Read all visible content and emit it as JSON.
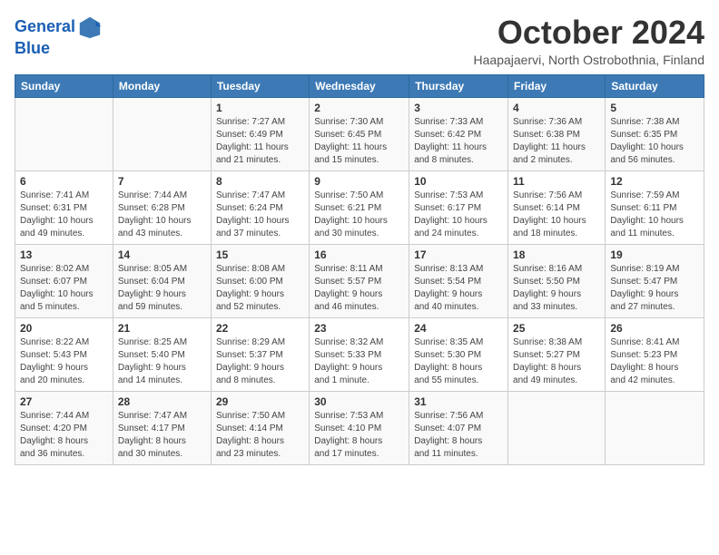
{
  "logo": {
    "line1": "General",
    "line2": "Blue"
  },
  "title": "October 2024",
  "subtitle": "Haapajaervi, North Ostrobothnia, Finland",
  "days_of_week": [
    "Sunday",
    "Monday",
    "Tuesday",
    "Wednesday",
    "Thursday",
    "Friday",
    "Saturday"
  ],
  "weeks": [
    [
      {
        "num": "",
        "info": ""
      },
      {
        "num": "",
        "info": ""
      },
      {
        "num": "1",
        "info": "Sunrise: 7:27 AM\nSunset: 6:49 PM\nDaylight: 11 hours\nand 21 minutes."
      },
      {
        "num": "2",
        "info": "Sunrise: 7:30 AM\nSunset: 6:45 PM\nDaylight: 11 hours\nand 15 minutes."
      },
      {
        "num": "3",
        "info": "Sunrise: 7:33 AM\nSunset: 6:42 PM\nDaylight: 11 hours\nand 8 minutes."
      },
      {
        "num": "4",
        "info": "Sunrise: 7:36 AM\nSunset: 6:38 PM\nDaylight: 11 hours\nand 2 minutes."
      },
      {
        "num": "5",
        "info": "Sunrise: 7:38 AM\nSunset: 6:35 PM\nDaylight: 10 hours\nand 56 minutes."
      }
    ],
    [
      {
        "num": "6",
        "info": "Sunrise: 7:41 AM\nSunset: 6:31 PM\nDaylight: 10 hours\nand 49 minutes."
      },
      {
        "num": "7",
        "info": "Sunrise: 7:44 AM\nSunset: 6:28 PM\nDaylight: 10 hours\nand 43 minutes."
      },
      {
        "num": "8",
        "info": "Sunrise: 7:47 AM\nSunset: 6:24 PM\nDaylight: 10 hours\nand 37 minutes."
      },
      {
        "num": "9",
        "info": "Sunrise: 7:50 AM\nSunset: 6:21 PM\nDaylight: 10 hours\nand 30 minutes."
      },
      {
        "num": "10",
        "info": "Sunrise: 7:53 AM\nSunset: 6:17 PM\nDaylight: 10 hours\nand 24 minutes."
      },
      {
        "num": "11",
        "info": "Sunrise: 7:56 AM\nSunset: 6:14 PM\nDaylight: 10 hours\nand 18 minutes."
      },
      {
        "num": "12",
        "info": "Sunrise: 7:59 AM\nSunset: 6:11 PM\nDaylight: 10 hours\nand 11 minutes."
      }
    ],
    [
      {
        "num": "13",
        "info": "Sunrise: 8:02 AM\nSunset: 6:07 PM\nDaylight: 10 hours\nand 5 minutes."
      },
      {
        "num": "14",
        "info": "Sunrise: 8:05 AM\nSunset: 6:04 PM\nDaylight: 9 hours\nand 59 minutes."
      },
      {
        "num": "15",
        "info": "Sunrise: 8:08 AM\nSunset: 6:00 PM\nDaylight: 9 hours\nand 52 minutes."
      },
      {
        "num": "16",
        "info": "Sunrise: 8:11 AM\nSunset: 5:57 PM\nDaylight: 9 hours\nand 46 minutes."
      },
      {
        "num": "17",
        "info": "Sunrise: 8:13 AM\nSunset: 5:54 PM\nDaylight: 9 hours\nand 40 minutes."
      },
      {
        "num": "18",
        "info": "Sunrise: 8:16 AM\nSunset: 5:50 PM\nDaylight: 9 hours\nand 33 minutes."
      },
      {
        "num": "19",
        "info": "Sunrise: 8:19 AM\nSunset: 5:47 PM\nDaylight: 9 hours\nand 27 minutes."
      }
    ],
    [
      {
        "num": "20",
        "info": "Sunrise: 8:22 AM\nSunset: 5:43 PM\nDaylight: 9 hours\nand 20 minutes."
      },
      {
        "num": "21",
        "info": "Sunrise: 8:25 AM\nSunset: 5:40 PM\nDaylight: 9 hours\nand 14 minutes."
      },
      {
        "num": "22",
        "info": "Sunrise: 8:29 AM\nSunset: 5:37 PM\nDaylight: 9 hours\nand 8 minutes."
      },
      {
        "num": "23",
        "info": "Sunrise: 8:32 AM\nSunset: 5:33 PM\nDaylight: 9 hours\nand 1 minute."
      },
      {
        "num": "24",
        "info": "Sunrise: 8:35 AM\nSunset: 5:30 PM\nDaylight: 8 hours\nand 55 minutes."
      },
      {
        "num": "25",
        "info": "Sunrise: 8:38 AM\nSunset: 5:27 PM\nDaylight: 8 hours\nand 49 minutes."
      },
      {
        "num": "26",
        "info": "Sunrise: 8:41 AM\nSunset: 5:23 PM\nDaylight: 8 hours\nand 42 minutes."
      }
    ],
    [
      {
        "num": "27",
        "info": "Sunrise: 7:44 AM\nSunset: 4:20 PM\nDaylight: 8 hours\nand 36 minutes."
      },
      {
        "num": "28",
        "info": "Sunrise: 7:47 AM\nSunset: 4:17 PM\nDaylight: 8 hours\nand 30 minutes."
      },
      {
        "num": "29",
        "info": "Sunrise: 7:50 AM\nSunset: 4:14 PM\nDaylight: 8 hours\nand 23 minutes."
      },
      {
        "num": "30",
        "info": "Sunrise: 7:53 AM\nSunset: 4:10 PM\nDaylight: 8 hours\nand 17 minutes."
      },
      {
        "num": "31",
        "info": "Sunrise: 7:56 AM\nSunset: 4:07 PM\nDaylight: 8 hours\nand 11 minutes."
      },
      {
        "num": "",
        "info": ""
      },
      {
        "num": "",
        "info": ""
      }
    ]
  ]
}
